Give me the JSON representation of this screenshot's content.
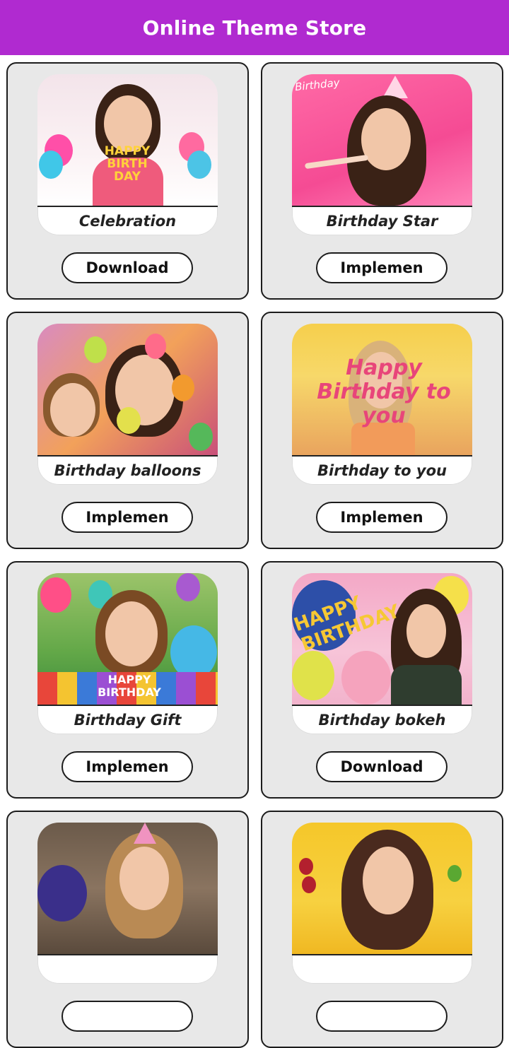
{
  "header": {
    "title": "Online Theme Store"
  },
  "colors": {
    "appbar": "#b02ad0",
    "card_bg": "#e8e8e8"
  },
  "themes": [
    {
      "name": "Celebration",
      "action": "Download",
      "art_text": "HAPPY BIRTH DAY"
    },
    {
      "name": "Birthday Star",
      "action": "Implemen",
      "art_text": "Birthday"
    },
    {
      "name": "Birthday balloons",
      "action": "Implemen"
    },
    {
      "name": "Birthday to you",
      "action": "Implemen",
      "art_text": "Happy Birthday to you"
    },
    {
      "name": "Birthday Gift",
      "action": "Implemen",
      "art_text": "HAPPY BIRTHDAY"
    },
    {
      "name": "Birthday bokeh",
      "action": "Download",
      "art_text": "HAPPY BIRTHDAY"
    },
    {
      "name": "",
      "action": ""
    },
    {
      "name": "",
      "action": ""
    }
  ]
}
